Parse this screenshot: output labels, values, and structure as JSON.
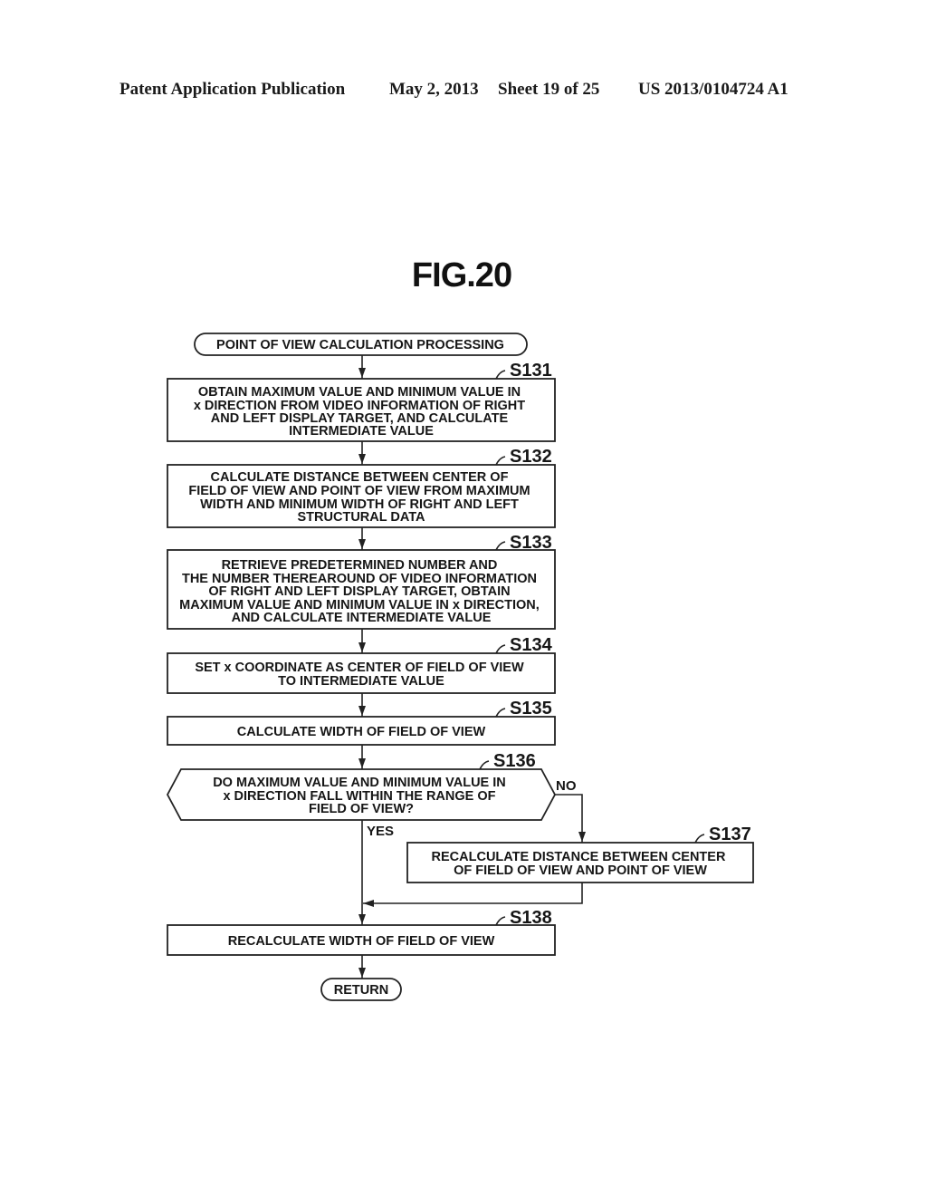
{
  "header": {
    "publication": "Patent Application Publication",
    "date": "May 2, 2013",
    "sheet": "Sheet 19 of 25",
    "number": "US 2013/0104724 A1"
  },
  "figure": {
    "title": "FIG.20"
  },
  "flowchart": {
    "start": {
      "text": "POINT OF VIEW CALCULATION PROCESSING"
    },
    "steps": [
      {
        "id": "S131",
        "lines": [
          "OBTAIN MAXIMUM VALUE AND MINIMUM VALUE IN",
          "x DIRECTION FROM VIDEO INFORMATION OF RIGHT",
          "AND LEFT DISPLAY TARGET, AND CALCULATE",
          "INTERMEDIATE VALUE"
        ]
      },
      {
        "id": "S132",
        "lines": [
          "CALCULATE DISTANCE BETWEEN CENTER OF",
          "FIELD OF VIEW AND POINT OF VIEW FROM MAXIMUM",
          "WIDTH AND MINIMUM WIDTH OF RIGHT AND LEFT",
          "STRUCTURAL DATA"
        ]
      },
      {
        "id": "S133",
        "lines": [
          "RETRIEVE PREDETERMINED NUMBER AND",
          "THE NUMBER THEREAROUND OF VIDEO INFORMATION",
          "OF RIGHT AND LEFT DISPLAY TARGET, OBTAIN",
          "MAXIMUM VALUE AND MINIMUM VALUE IN x DIRECTION,",
          "AND CALCULATE INTERMEDIATE VALUE"
        ]
      },
      {
        "id": "S134",
        "lines": [
          "SET x COORDINATE AS CENTER OF FIELD OF VIEW",
          "TO INTERMEDIATE VALUE"
        ]
      },
      {
        "id": "S135",
        "lines": [
          "CALCULATE WIDTH OF FIELD OF VIEW"
        ]
      },
      {
        "id": "S136",
        "type": "decision",
        "lines": [
          "DO MAXIMUM VALUE AND MINIMUM VALUE IN",
          "x DIRECTION FALL WITHIN THE RANGE OF",
          "FIELD OF VIEW?"
        ]
      },
      {
        "id": "S137",
        "lines": [
          "RECALCULATE DISTANCE BETWEEN CENTER",
          "OF FIELD OF VIEW AND POINT OF VIEW"
        ]
      },
      {
        "id": "S138",
        "lines": [
          "RECALCULATE WIDTH OF FIELD OF VIEW"
        ]
      }
    ],
    "branches": {
      "yes": "YES",
      "no": "NO"
    },
    "end": {
      "text": "RETURN"
    }
  }
}
